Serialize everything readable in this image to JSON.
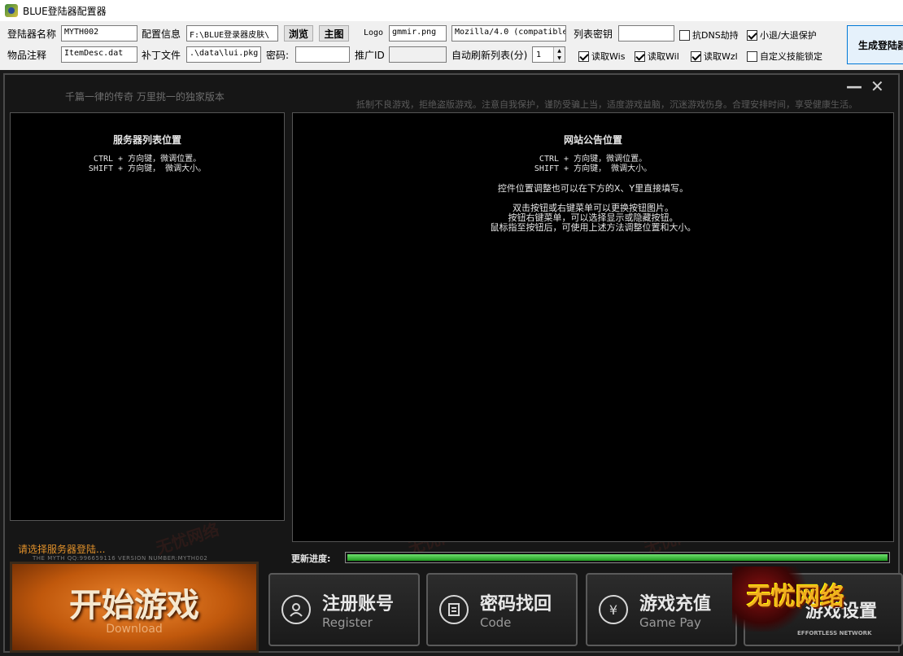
{
  "window": {
    "title": "BLUE登陆器配置器"
  },
  "config": {
    "row1": {
      "launcher_name_label": "登陆器名称",
      "launcher_name_value": "MYTH002",
      "config_info_label": "配置信息",
      "config_info_value": "F:\\BLUE登录器皮肤\\",
      "browse_label": "浏览",
      "home_label": "主图",
      "logo_label": "Logo",
      "logo_value": "gmmir.png",
      "ua_value": "Mozilla/4.0 (compatible",
      "list_key_label": "列表密钥",
      "list_key_value": "",
      "anti_dns_label": "抗DNS劫持",
      "anti_dns_checked": false,
      "quit_protect_label": "小退/大退保护",
      "quit_protect_checked": true
    },
    "row2": {
      "item_note_label": "物品注释",
      "item_note_value": "ItemDesc.dat",
      "patch_label": "补丁文件",
      "patch_value": ".\\data\\lui.pkg",
      "password_label": "密码:",
      "password_value": "",
      "promo_label": "推广ID",
      "promo_value": "",
      "refresh_label": "自动刷新列表(分)",
      "refresh_value": "1",
      "read_wis_label": "读取Wis",
      "read_wis_checked": true,
      "read_wil_label": "读取Wil",
      "read_wil_checked": true,
      "read_wzl_label": "读取Wzl",
      "read_wzl_checked": true,
      "custom_skill_label": "自定义技能锁定",
      "custom_skill_checked": false
    },
    "generate_label": "生成登陆器"
  },
  "skin": {
    "slogan": "千篇一律的传奇 万里挑一的独家版本",
    "notice": "抵制不良游戏，拒绝盗版游戏。注意自我保护，谨防受骗上当，适度游戏益脑，沉迷游戏伤身。合理安排时间，享受健康生活。",
    "minimize_glyph": "—",
    "close_glyph": "✕",
    "server_panel": {
      "title": "服务器列表位置",
      "line1": "CTRL + 方向键，微调位置。",
      "line2": "SHIFT + 方向键， 微调大小。"
    },
    "web_panel": {
      "title": "网站公告位置",
      "line1": "CTRL + 方向键，微调位置。",
      "line2": "SHIFT + 方向键， 微调大小。",
      "line3": "控件位置调整也可以在下方的X、Y里直接填写。",
      "line4": "双击按钮或右键菜单可以更换按钮图片。",
      "line5": "按钮右键菜单，可以选择显示或隐藏按钮。",
      "line6": "鼠标指至按钮后，可使用上述方法调整位置和大小。"
    },
    "select_server": "请选择服务器登陆...",
    "small_info": "THE MYTH QQ:996659116  VERSION NUMBER:MYTH002",
    "progress_label": "更新进度:",
    "progress_value": 1.0,
    "start": {
      "label": "开始游戏",
      "sub": "Download"
    },
    "register": {
      "label": "注册账号",
      "sub": "Register",
      "icon": "user-icon"
    },
    "recover": {
      "label": "密码找回",
      "sub": "Code",
      "icon": "document-icon"
    },
    "recharge": {
      "label": "游戏充值",
      "sub": "Game Pay",
      "icon": "yen-icon"
    },
    "settings_partial": "游戏设置",
    "brand": {
      "label": "无忧网络",
      "sub": "EFFORTLESS NETWORK"
    },
    "watermark_text": "无忧网络"
  },
  "colors": {
    "progress": "#2fbf2f",
    "start_orange": "#d8641a",
    "brand_gold": "#f2b020",
    "server_text": "#e0902a"
  }
}
